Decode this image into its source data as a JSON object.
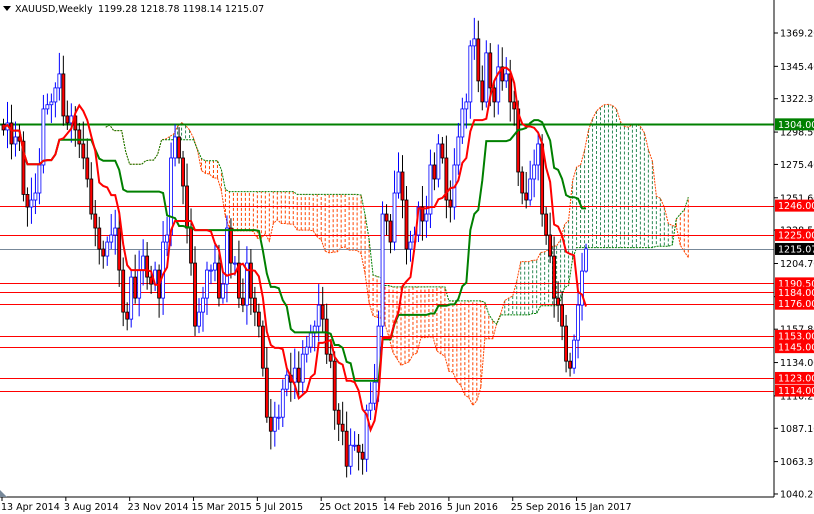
{
  "header": {
    "symbol": "XAUUSD,Weekly",
    "ohlc": "1199.28 1218.78 1198.14 1215.07"
  },
  "colors": {
    "bull": "#0000ff",
    "bear": "#ff0000",
    "tenkan": "#ff0000",
    "kijun": "#008000",
    "cloud_bear": "#ff4500",
    "cloud_bull": "#2e8b57",
    "support_resistance": "#ff0000",
    "key_level": "#008000",
    "price_line": "#778899"
  },
  "chart_data": {
    "type": "candlestick",
    "title": "XAUUSD,Weekly",
    "indicator": "Ichimoku (9, 26, 52)",
    "ylim": [
      1040.2,
      1369.2
    ],
    "y_ticks": [
      "1369.20",
      "1345.40",
      "1322.30",
      "1298.50",
      "1275.40",
      "1251.60",
      "1228.50",
      "1204.70",
      "1181.00",
      "1157.80",
      "1134.00",
      "1110.20",
      "1087.10",
      "1063.30",
      "1040.20"
    ],
    "x_labels": [
      "13 Apr 2014",
      "3 Aug 2014",
      "23 Nov 2014",
      "15 Mar 2015",
      "5 Jul 2015",
      "25 Oct 2015",
      "14 Feb 2016",
      "5 Jun 2016",
      "25 Sep 2016",
      "15 Jan 2017"
    ],
    "x_label_week_index": [
      0,
      16,
      32,
      48,
      64,
      80,
      96,
      112,
      128,
      144
    ],
    "closes": [
      1300,
      1305,
      1290,
      1295,
      1292,
      1254,
      1245,
      1250,
      1255,
      1275,
      1315,
      1318,
      1320,
      1330,
      1340,
      1310,
      1305,
      1310,
      1300,
      1290,
      1280,
      1265,
      1240,
      1230,
      1215,
      1210,
      1220,
      1225,
      1230,
      1200,
      1170,
      1165,
      1195,
      1180,
      1200,
      1210,
      1195,
      1190,
      1200,
      1180,
      1220,
      1225,
      1280,
      1295,
      1280,
      1260,
      1230,
      1205,
      1160,
      1170,
      1180,
      1200,
      1200,
      1205,
      1180,
      1190,
      1230,
      1205,
      1205,
      1180,
      1175,
      1205,
      1180,
      1170,
      1160,
      1130,
      1095,
      1085,
      1095,
      1095,
      1115,
      1125,
      1120,
      1130,
      1120,
      1140,
      1145,
      1155,
      1160,
      1175,
      1165,
      1140,
      1135,
      1100,
      1090,
      1085,
      1060,
      1075,
      1075,
      1070,
      1065,
      1100,
      1105,
      1120,
      1160,
      1240,
      1235,
      1220,
      1255,
      1270,
      1250,
      1215,
      1220,
      1225,
      1245,
      1235,
      1240,
      1275,
      1265,
      1290,
      1280,
      1250,
      1245,
      1275,
      1295,
      1315,
      1320,
      1360,
      1365,
      1335,
      1320,
      1355,
      1330,
      1320,
      1345,
      1335,
      1340,
      1320,
      1315,
      1270,
      1255,
      1250,
      1265,
      1275,
      1290,
      1240,
      1225,
      1210,
      1180,
      1175,
      1160,
      1135,
      1130,
      1150,
      1175,
      1199.28,
      1215.07
    ],
    "last_candle": {
      "open": 1199.28,
      "high": 1218.78,
      "low": 1198.14,
      "close": 1215.07
    },
    "levels": [
      {
        "value": 1304.0,
        "label": "1304.00",
        "kind": "key"
      },
      {
        "value": 1246.0,
        "label": "1246.00",
        "kind": "sr"
      },
      {
        "value": 1225.0,
        "label": "1225.00",
        "kind": "sr"
      },
      {
        "value": 1215.07,
        "label": "1215.07",
        "kind": "price"
      },
      {
        "value": 1190.5,
        "label": "1190.50",
        "kind": "sr"
      },
      {
        "value": 1184.0,
        "label": "1184.00",
        "kind": "sr"
      },
      {
        "value": 1176.0,
        "label": "1176.00",
        "kind": "sr"
      },
      {
        "value": 1153.0,
        "label": "1153.00",
        "kind": "sr"
      },
      {
        "value": 1145.0,
        "label": "1145.00",
        "kind": "sr"
      },
      {
        "value": 1123.0,
        "label": "1123.00",
        "kind": "sr"
      },
      {
        "value": 1114.0,
        "label": "1114.00",
        "kind": "sr"
      }
    ]
  }
}
